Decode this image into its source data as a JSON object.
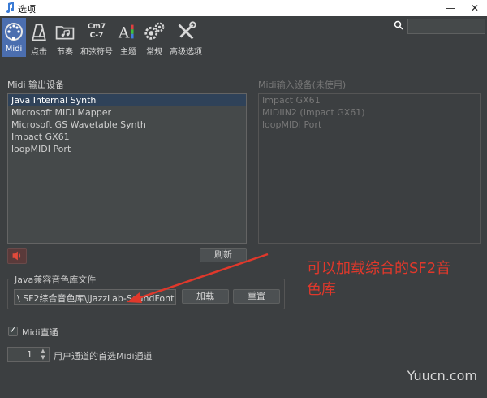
{
  "window": {
    "title": "选项",
    "minimize": "—",
    "close": "✕"
  },
  "toolbar": {
    "tabs": [
      {
        "label": "Midi",
        "icon": "midi-connector-icon",
        "active": true
      },
      {
        "label": "点击",
        "icon": "metronome-icon",
        "active": false
      },
      {
        "label": "节奏",
        "icon": "folder-music-icon",
        "active": false
      },
      {
        "label": "和弦符号",
        "icon": "chord-symbol-icon",
        "chord_top": "Cm7",
        "chord_bottom": "C-7",
        "active": false
      },
      {
        "label": "主题",
        "icon": "theme-icon",
        "active": false
      },
      {
        "label": "常规",
        "icon": "gear-icon",
        "active": false
      },
      {
        "label": "高级选项",
        "icon": "tools-icon",
        "active": false
      }
    ],
    "search_value": ""
  },
  "midi_out": {
    "label": "Midi 输出设备",
    "items": [
      "Java Internal Synth",
      "Microsoft MIDI Mapper",
      "Microsoft GS Wavetable Synth",
      "Impact GX61",
      "loopMIDI Port"
    ],
    "selected_index": 0
  },
  "midi_in": {
    "label": "Midi输入设备(未使用)",
    "items": [
      "Impact GX61",
      "MIDIIN2 (Impact GX61)",
      "loopMIDI Port"
    ]
  },
  "buttons": {
    "refresh": "刷新",
    "load": "加载",
    "reset": "重置"
  },
  "soundfont": {
    "group_title": "Java兼容音色库文件",
    "path": "\\ SF2综合音色库\\JJazzLab-SoundFont.sf2"
  },
  "midi_thru": {
    "label": "Midi直通",
    "checked": true
  },
  "channel": {
    "value": "1",
    "label": "用户通道的首选Midi通道"
  },
  "annotation": {
    "line1": "可以加载综合的SF2音",
    "line2": "色库"
  },
  "watermark": "Yuucn.com",
  "colors": {
    "accent": "#4b6eaf",
    "annotation": "#e0382b",
    "background": "#3c3f41"
  }
}
